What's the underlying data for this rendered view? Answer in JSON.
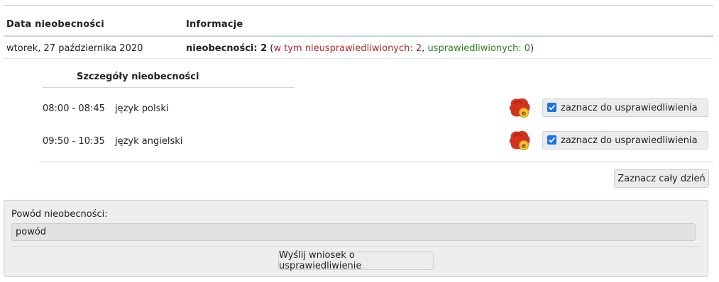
{
  "header": {
    "col_date": "Data nieobecności",
    "col_info": "Informacje"
  },
  "summary": {
    "date": "wtorek, 27 października 2020",
    "absences_label": "nieobecności: 2",
    "open_paren": " (",
    "unexcused_label": "w tym nieusprawiedliwionych: 2",
    "separator": ", ",
    "excused_label": "usprawiedliwionych: 0",
    "close_paren": ")"
  },
  "details": {
    "title": "Szczegóły nieobecności",
    "rows": [
      {
        "time": "08:00 - 08:45",
        "subject": "język polski",
        "icon": "absence-avatar-icon",
        "checked": true,
        "checkbox_label": "zaznacz do usprawiedliwienia"
      },
      {
        "time": "09:50 - 10:35",
        "subject": "język angielski",
        "icon": "absence-avatar-icon",
        "checked": true,
        "checkbox_label": "zaznacz do usprawiedliwienia"
      }
    ],
    "select_day_button": "Zaznacz cały dzień"
  },
  "form": {
    "reason_label": "Powód nieobecności:",
    "reason_value": "powód",
    "submit_button": "Wyślij wniosek o usprawiedliwienie"
  },
  "colors": {
    "unexcused": "#b52727",
    "excused": "#2e7d22",
    "checkbox": "#1a73e8",
    "icon_main": "#d2321e",
    "icon_badge": "#f2c230"
  }
}
